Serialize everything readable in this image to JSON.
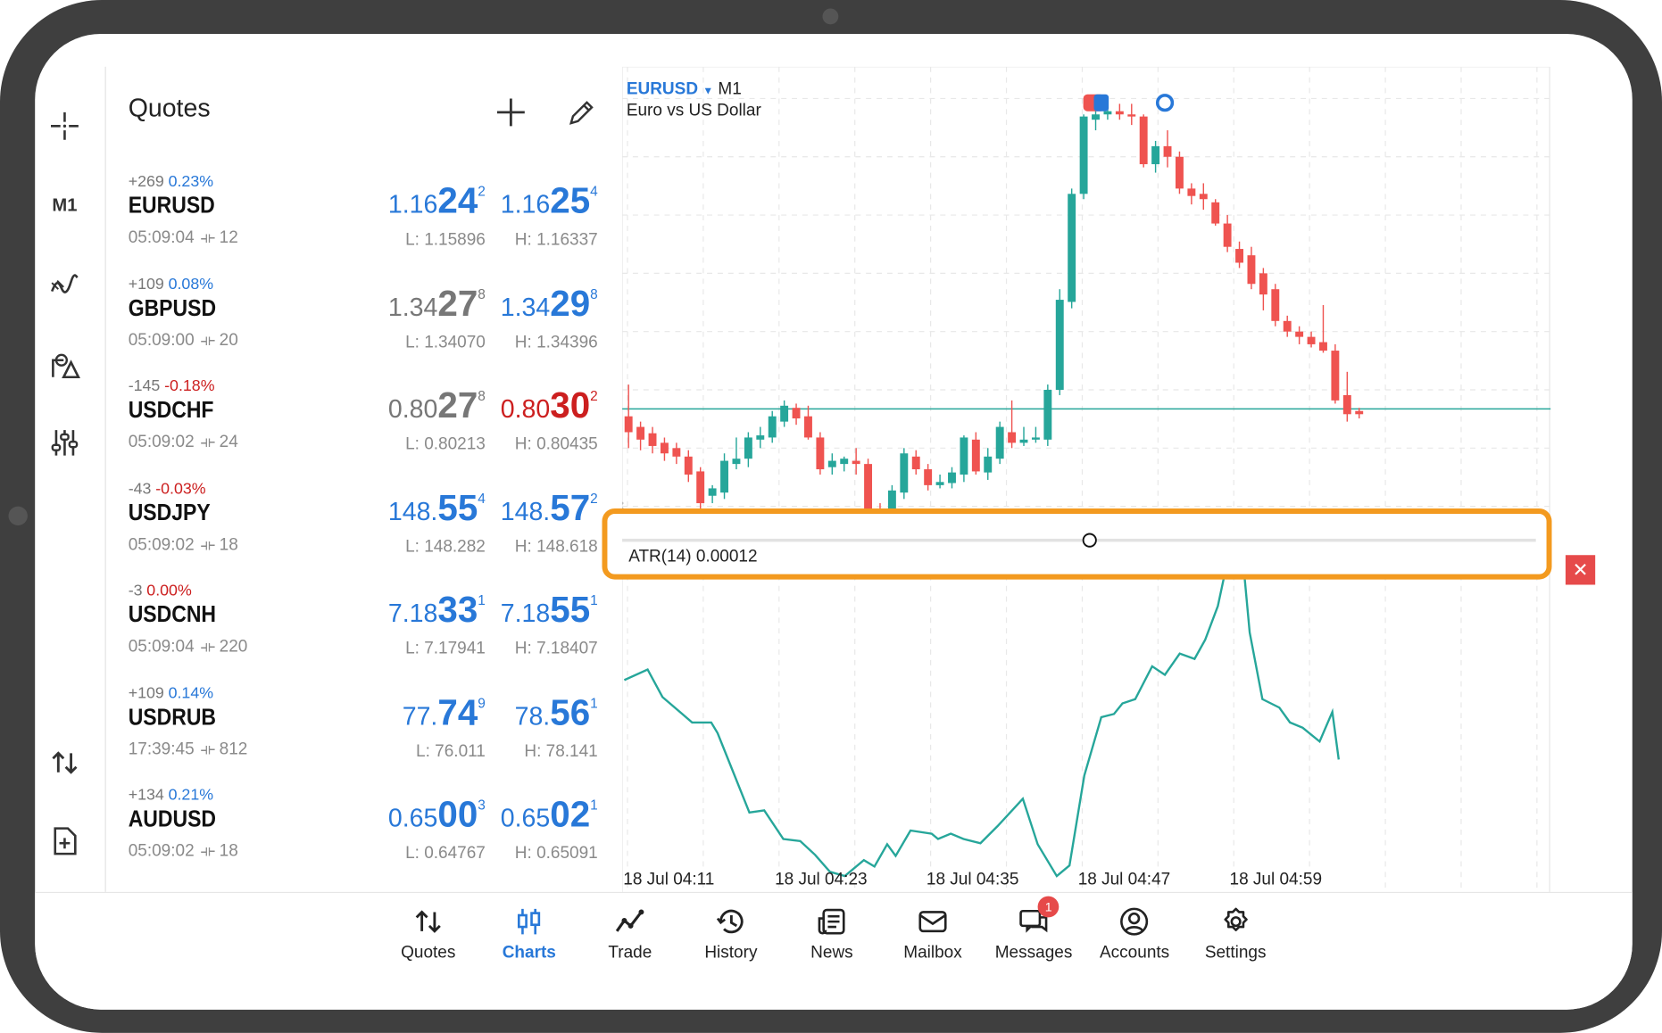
{
  "toolbar": {
    "timeframe": "M1"
  },
  "quotes": {
    "title": "Quotes",
    "rows": [
      {
        "change": "+269",
        "pct": "0.23%",
        "pct_color": "blue",
        "symbol": "EURUSD",
        "time": "05:09:04",
        "spread": "12",
        "bid": {
          "small": "1.16",
          "big": "24",
          "sup": "2",
          "color": "blue"
        },
        "ask": {
          "small": "1.16",
          "big": "25",
          "sup": "4",
          "color": "blue"
        },
        "low": "L: 1.15896",
        "high": "H: 1.16337"
      },
      {
        "change": "+109",
        "pct": "0.08%",
        "pct_color": "blue",
        "symbol": "GBPUSD",
        "time": "05:09:00",
        "spread": "20",
        "bid": {
          "small": "1.34",
          "big": "27",
          "sup": "8",
          "color": "gray"
        },
        "ask": {
          "small": "1.34",
          "big": "29",
          "sup": "8",
          "color": "blue"
        },
        "low": "L: 1.34070",
        "high": "H: 1.34396"
      },
      {
        "change": "-145",
        "pct": "-0.18%",
        "pct_color": "red",
        "symbol": "USDCHF",
        "time": "05:09:02",
        "spread": "24",
        "bid": {
          "small": "0.80",
          "big": "27",
          "sup": "8",
          "color": "gray"
        },
        "ask": {
          "small": "0.80",
          "big": "30",
          "sup": "2",
          "color": "red"
        },
        "low": "L: 0.80213",
        "high": "H: 0.80435"
      },
      {
        "change": "-43",
        "pct": "-0.03%",
        "pct_color": "red",
        "symbol": "USDJPY",
        "time": "05:09:02",
        "spread": "18",
        "bid": {
          "small": "148.",
          "big": "55",
          "sup": "4",
          "color": "blue"
        },
        "ask": {
          "small": "148.",
          "big": "57",
          "sup": "2",
          "color": "blue"
        },
        "low": "L: 148.282",
        "high": "H: 148.618"
      },
      {
        "change": "-3",
        "pct": "0.00%",
        "pct_color": "red",
        "symbol": "USDCNH",
        "time": "05:09:04",
        "spread": "220",
        "bid": {
          "small": "7.18",
          "big": "33",
          "sup": "1",
          "color": "blue"
        },
        "ask": {
          "small": "7.18",
          "big": "55",
          "sup": "1",
          "color": "blue"
        },
        "low": "L: 7.17941",
        "high": "H: 7.18407"
      },
      {
        "change": "+109",
        "pct": "0.14%",
        "pct_color": "blue",
        "symbol": "USDRUB",
        "time": "17:39:45",
        "spread": "812",
        "bid": {
          "small": "77.",
          "big": "74",
          "sup": "9",
          "color": "blue"
        },
        "ask": {
          "small": "78.",
          "big": "56",
          "sup": "1",
          "color": "blue"
        },
        "low": "L: 76.011",
        "high": "H: 78.141"
      },
      {
        "change": "+134",
        "pct": "0.21%",
        "pct_color": "blue",
        "symbol": "AUDUSD",
        "time": "05:09:02",
        "spread": "18",
        "bid": {
          "small": "0.65",
          "big": "00",
          "sup": "3",
          "color": "blue"
        },
        "ask": {
          "small": "0.65",
          "big": "02",
          "sup": "1",
          "color": "blue"
        },
        "low": "L: 0.64767",
        "high": "H: 0.65091"
      }
    ]
  },
  "chart": {
    "symbol": "EURUSD",
    "timeframe": "M1",
    "description": "Euro vs US Dollar",
    "indicator_label": "ATR(14) 0.00012",
    "time_labels": [
      "18 Jul 04:11",
      "18 Jul 04:23",
      "18 Jul 04:35",
      "18 Jul 04:47",
      "18 Jul 04:59"
    ],
    "colors": {
      "bull": "#26a69a",
      "bear": "#ef5350",
      "highlight": "#f39a1f"
    }
  },
  "nav": {
    "items": [
      {
        "label": "Quotes",
        "icon": "quotes-icon"
      },
      {
        "label": "Charts",
        "icon": "charts-icon",
        "active": true
      },
      {
        "label": "Trade",
        "icon": "trade-icon"
      },
      {
        "label": "History",
        "icon": "history-icon"
      },
      {
        "label": "News",
        "icon": "news-icon"
      },
      {
        "label": "Mailbox",
        "icon": "mailbox-icon"
      },
      {
        "label": "Messages",
        "icon": "messages-icon",
        "badge": "1"
      },
      {
        "label": "Accounts",
        "icon": "accounts-icon"
      },
      {
        "label": "Settings",
        "icon": "settings-icon"
      }
    ]
  }
}
